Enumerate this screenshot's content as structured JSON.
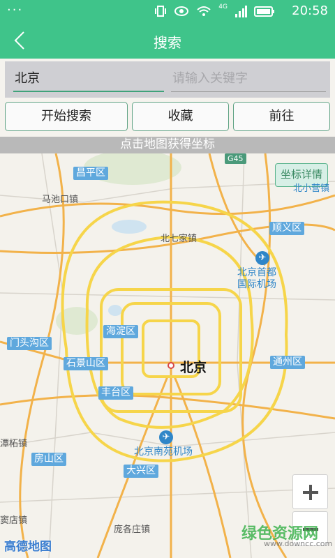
{
  "statusbar": {
    "menu": "···",
    "network": "4G",
    "time": "20:58"
  },
  "header": {
    "title": "搜索"
  },
  "search": {
    "city_value": "北京",
    "keyword_placeholder": "请输入关键字"
  },
  "buttons": {
    "search": "开始搜索",
    "favorite": "收藏",
    "goto": "前往"
  },
  "hint": "点击地图获得坐标",
  "map": {
    "coord_detail_button": "坐标详情",
    "highway_badge": "G45",
    "center_label": "北京",
    "districts": [
      "昌平区",
      "顺义区",
      "门头沟区",
      "海淀区",
      "石景山区",
      "丰台区",
      "通州区",
      "房山区",
      "大兴区"
    ],
    "towns": [
      "马池口镇",
      "北七家镇",
      "北小营镇",
      "潭柘镇",
      "窦店镇",
      "庞各庄镇"
    ],
    "pois": {
      "capital_airport": "北京首都\n国际机场",
      "nanyuan_airport": "北京南苑机场"
    },
    "logo": "高德地图",
    "watermark": "绿色资源网",
    "watermark_url": "www.downcc.com",
    "zoom_in": "+",
    "zoom_out": "−"
  }
}
